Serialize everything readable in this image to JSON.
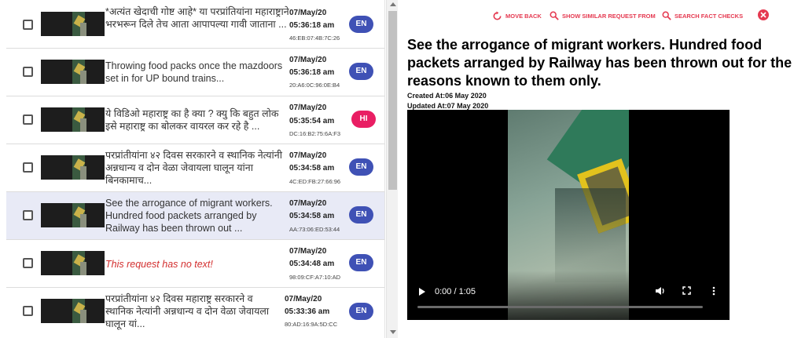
{
  "requests": [
    {
      "text": "*अत्यंत खेदाची गोष्ट आहे* या परप्रांतियांना महाराष्ट्राने भरभरून दिले तेच आता आपापल्या गावी जाताना ...",
      "date": "07/May/20",
      "time": "05:36:18 am",
      "mac": "46:EB:07:4B:7C:26",
      "lang": "EN",
      "lang_color": "#3f51b5",
      "italic_red": false
    },
    {
      "text": "Throwing food packs once the mazdoors set in for UP bound trains...",
      "date": "07/May/20",
      "time": "05:36:18 am",
      "mac": "20:A6:0C:96:0E:B4",
      "lang": "EN",
      "lang_color": "#3f51b5",
      "italic_red": false
    },
    {
      "text": "ये विडिओ महाराष्ट्र का है क्या ? क्यु कि बहुत लोक इसे महाराष्ट्र का बोलकर वायरल कर रहे है ...",
      "date": "07/May/20",
      "time": "05:35:54 am",
      "mac": "DC:16:B2:75:6A:F3",
      "lang": "HI",
      "lang_color": "#e91e63",
      "italic_red": false
    },
    {
      "text": "परप्रांतीयांना ४२ दिवस सरकारने व स्थानिक नेत्यांनी अन्नधान्य व दोन वेळा जेवायला घालून यांना बिनकामाच...",
      "date": "07/May/20",
      "time": "05:34:58 am",
      "mac": "4C:ED:FB:27:66:96",
      "lang": "EN",
      "lang_color": "#3f51b5",
      "italic_red": false
    },
    {
      "text": "See the arrogance of migrant workers. Hundred food packets arranged by Railway has been thrown out ...",
      "date": "07/May/20",
      "time": "05:34:58 am",
      "mac": "AA:73:06:ED:53:44",
      "lang": "EN",
      "lang_color": "#3f51b5",
      "italic_red": false
    },
    {
      "text": "This request has no text!",
      "date": "07/May/20",
      "time": "05:34:48 am",
      "mac": "98:09:CF:A7:10:AD",
      "lang": "EN",
      "lang_color": "#3f51b5",
      "italic_red": true
    },
    {
      "text": "परप्रांतीयांना ४२ दिवस महाराष्ट्र सरकारने व स्थानिक नेत्यांनी अन्नधान्य व दोन वेळा जेवायला घालून यां...",
      "date": "07/May/20",
      "time": "05:33:36 am",
      "mac": "80:AD:16:9A:5D:CC",
      "lang": "EN",
      "lang_color": "#3f51b5",
      "italic_red": false
    }
  ],
  "toolbar": {
    "move_back": "MOVE BACK",
    "show_similar": "SHOW SIMILAR REQUEST FROM",
    "search_fact": "SEARCH FACT CHECKS"
  },
  "detail": {
    "title": "See the arrogance of migrant workers. Hundred food packets arranged by Railway has been thrown out for the reasons known to them only.",
    "created": "Created At:06 May 2020",
    "updated": "Updated At:07 May 2020"
  },
  "video": {
    "time": "0:00 / 1:05"
  },
  "colors": {
    "accent": "#e53950",
    "selected_row": "#e8eaf6",
    "lang_en": "#3f51b5",
    "lang_hi": "#e91e63"
  }
}
